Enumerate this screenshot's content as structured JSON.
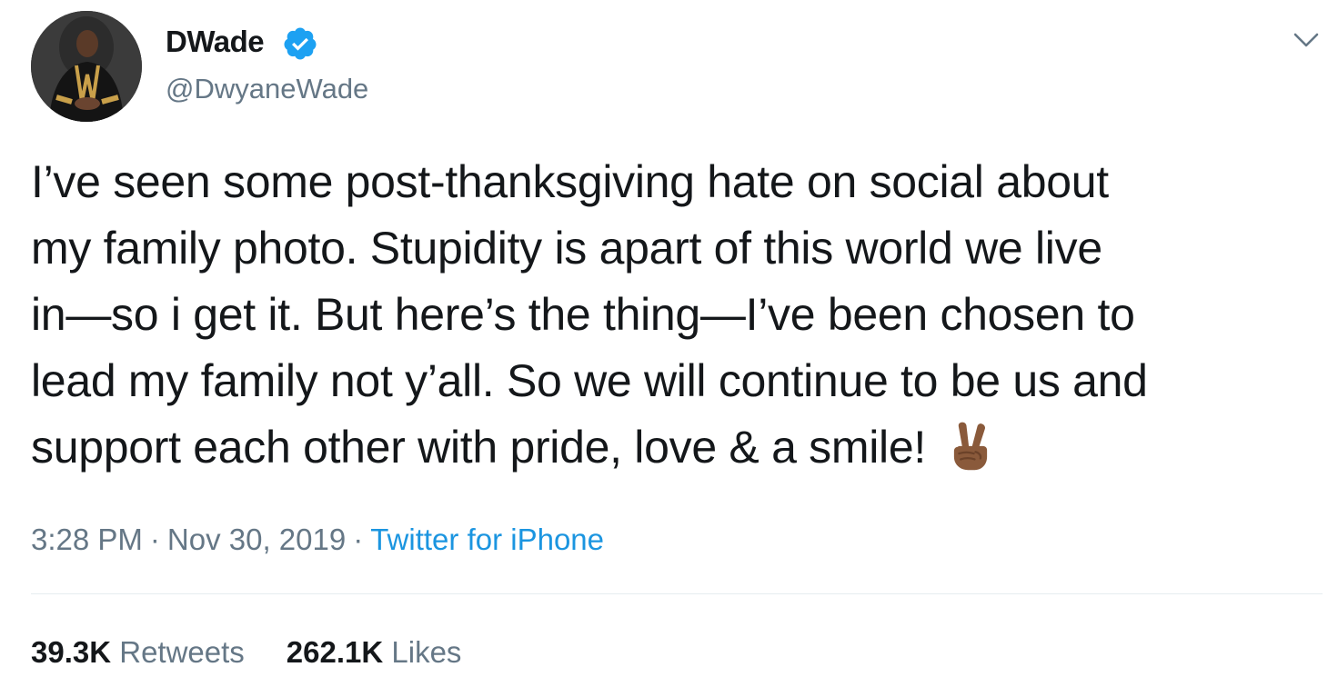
{
  "author": {
    "display_name": "DWade",
    "handle": "@DwyaneWade",
    "verified": true,
    "avatar_icon": "profile-photo"
  },
  "tweet": {
    "lines": [
      "I’ve seen some post-thanksgiving hate on social about",
      "my family photo. Stupidity is apart of this world we live",
      "in—so i get it. But here’s the thing—I’ve been chosen to",
      "lead my family not y’all. So we will continue to be us and",
      "support each other with pride, love & a smile!"
    ],
    "emoji": "victory-hand-medium-dark-skin-tone"
  },
  "meta": {
    "time": "3:28 PM",
    "date": "Nov 30, 2019",
    "separator": "·",
    "source": "Twitter for iPhone"
  },
  "stats": {
    "retweets_count": "39.3K",
    "retweets_label": "Retweets",
    "likes_count": "262.1K",
    "likes_label": "Likes"
  },
  "colors": {
    "text": "#14171a",
    "secondary": "#657786",
    "link": "#1b95e0",
    "verified": "#1da1f2",
    "divider": "#e6ecf0"
  }
}
